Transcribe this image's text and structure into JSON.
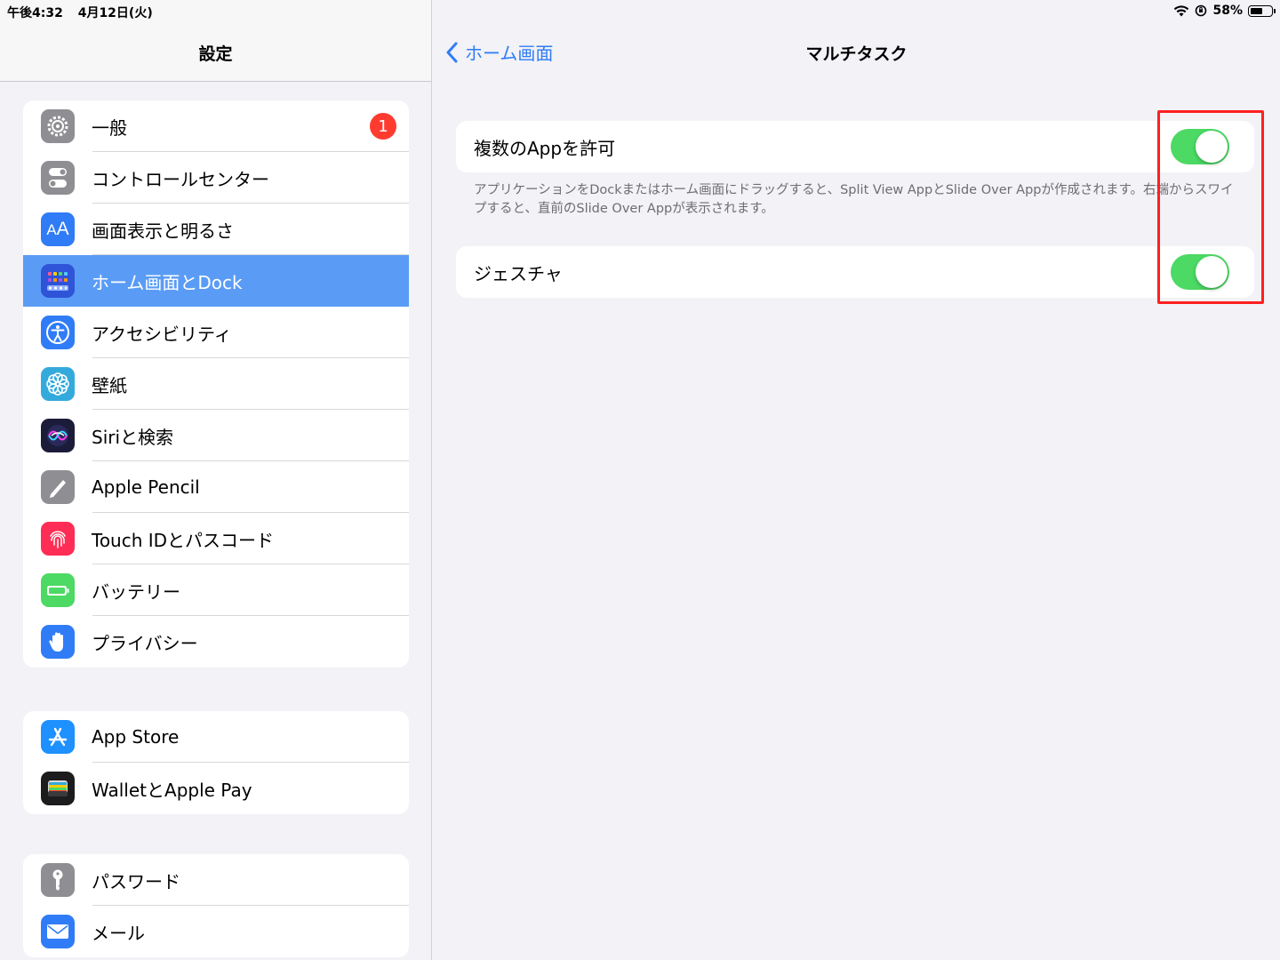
{
  "status_bar": {
    "time": "午後4:32",
    "date": "4月12日(火)",
    "battery": "58%",
    "battery_level": 0.58
  },
  "sidebar": {
    "title": "設定",
    "group1": [
      {
        "label": "一般",
        "icon": "gear-icon",
        "color": "#8e8e93",
        "badge": "1"
      },
      {
        "label": "コントロールセンター",
        "icon": "toggles-icon",
        "color": "#8e8e93"
      },
      {
        "label": "画面表示と明るさ",
        "icon": "text-size-icon",
        "color": "#2f7cf6"
      },
      {
        "label": "ホーム画面とDock",
        "icon": "home-grid-icon",
        "color": "#2f54d8",
        "selected": true
      },
      {
        "label": "アクセシビリティ",
        "icon": "accessibility-icon",
        "color": "#2f7cf6"
      },
      {
        "label": "壁紙",
        "icon": "flower-icon",
        "color": "#34aadc"
      },
      {
        "label": "Siriと検索",
        "icon": "siri-icon",
        "color": "#1c1c3a"
      },
      {
        "label": "Apple Pencil",
        "icon": "pencil-icon",
        "color": "#8e8e93"
      },
      {
        "label": "Touch IDとパスコード",
        "icon": "fingerprint-icon",
        "color": "#ff2d55"
      },
      {
        "label": "バッテリー",
        "icon": "battery-icon",
        "color": "#4cd964"
      },
      {
        "label": "プライバシー",
        "icon": "hand-icon",
        "color": "#2f7cf6"
      }
    ],
    "group2": [
      {
        "label": "App Store",
        "icon": "app-store-icon",
        "color": "#1e90ff"
      },
      {
        "label": "WalletとApple Pay",
        "icon": "wallet-icon",
        "color": "#1c1c1e"
      }
    ],
    "group3": [
      {
        "label": "パスワード",
        "icon": "key-icon",
        "color": "#8e8e93"
      },
      {
        "label": "メール",
        "icon": "mail-icon",
        "color": "#2f7cf6"
      }
    ]
  },
  "detail": {
    "back_label": "ホーム画面",
    "title": "マルチタスク",
    "setting1": {
      "label": "複数のAppを許可",
      "enabled": true
    },
    "footnote": "アプリケーションをDockまたはホーム画面にドラッグすると、Split View AppとSlide Over Appが作成されます。右端からスワイプすると、直前のSlide Over Appが表示されます。",
    "setting2": {
      "label": "ジェスチャ",
      "enabled": true
    },
    "highlight_color": "#ff1f1f",
    "toggle_on_color": "#4cd964",
    "accent_color": "#2f7cf6"
  }
}
